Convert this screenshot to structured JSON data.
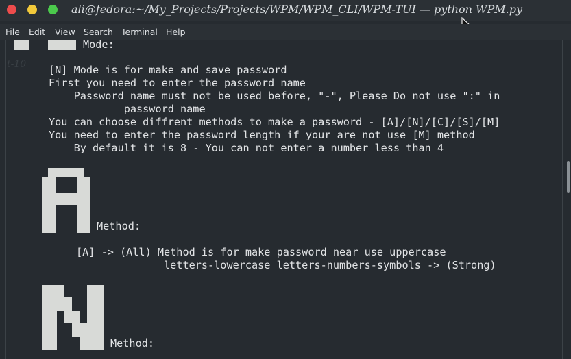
{
  "window": {
    "title": "ali@fedora:~/My_Projects/Projects/WPM/WPM_CLI/WPM-TUI — python WPM.py",
    "buttons": [
      {
        "name": "close",
        "color": "#ee4c4c"
      },
      {
        "name": "minimize",
        "color": "#f2c93a"
      },
      {
        "name": "maximize",
        "color": "#4bc94c"
      }
    ]
  },
  "menu": [
    "File",
    "Edit",
    "View",
    "Search",
    "Terminal",
    "Help"
  ],
  "terminal": {
    "ghost_text": "t-10",
    "mode_label": "Mode:",
    "lines": [
      "[N] Mode is for make and save password",
      "First you need to enter the password name",
      "    Password name must not be used before, \"-\", Please Do not use \":\" in",
      "            password name",
      "You can choose diffrent methods to make a password - [A]/[N]/[C]/[S]/[M]",
      "You need to enter the password length if your are not use [M] method",
      "    By default it is 8 - You can not enter a number less than 4"
    ],
    "method_a_label": "Method:",
    "method_a_lines": [
      "[A] -> (All) Method is for make password near use uppercase",
      "              letters-lowercase letters-numbers-symbols -> (Strong)"
    ],
    "method_n_label": "Method:"
  }
}
